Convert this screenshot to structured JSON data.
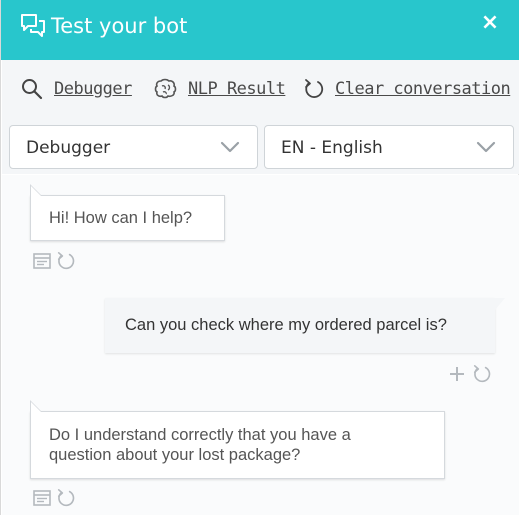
{
  "header": {
    "title": "Test your bot",
    "close_label": "×",
    "background": "#28c6cc"
  },
  "toolbar": {
    "debugger_label": "Debugger",
    "nlp_label": "NLP Result",
    "clear_label": "Clear conversation"
  },
  "selects": {
    "mode": "Debugger",
    "language": "EN - English"
  },
  "messages": [
    {
      "from": "bot",
      "text": "Hi! How can I help?"
    },
    {
      "from": "user",
      "text": "Can you check where my ordered parcel is?"
    },
    {
      "from": "bot",
      "line1": "Do I understand correctly that you have a",
      "line2": "question about your lost package?"
    }
  ],
  "icons": {
    "chat": "chat-bubbles-icon",
    "search": "search-icon",
    "brain": "brain-icon",
    "refresh": "refresh-icon",
    "chevron": "chevron-down-icon",
    "details": "details-card-icon",
    "plus": "plus-icon"
  }
}
